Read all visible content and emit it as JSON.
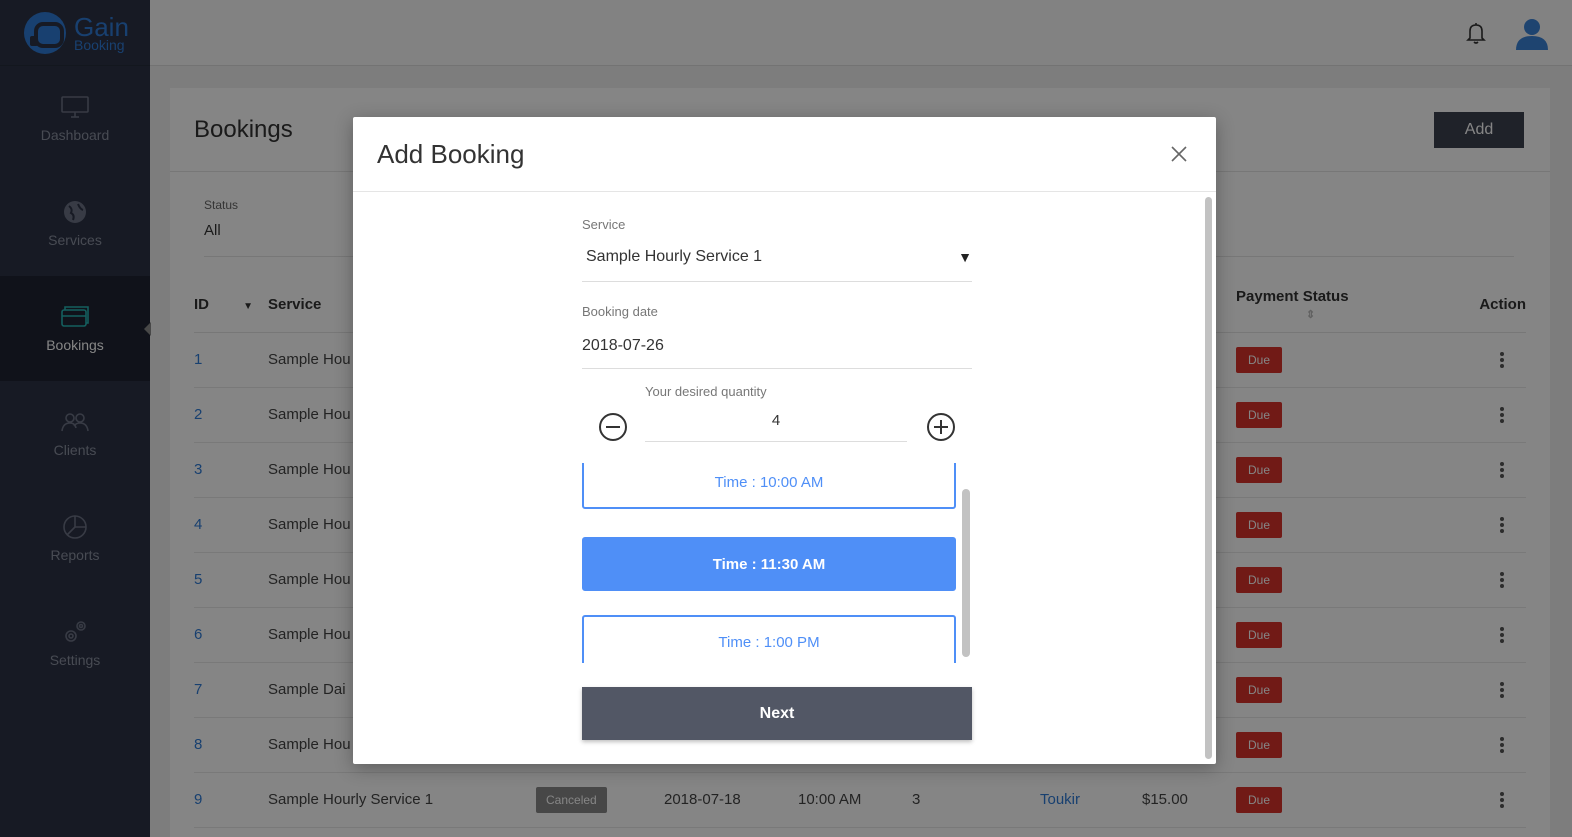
{
  "app": {
    "logo_big": "Gain",
    "logo_small": "Booking"
  },
  "sidebar": {
    "items": [
      {
        "label": "Dashboard",
        "icon": "monitor-icon"
      },
      {
        "label": "Services",
        "icon": "globe-icon"
      },
      {
        "label": "Bookings",
        "icon": "bookings-icon",
        "active": true
      },
      {
        "label": "Clients",
        "icon": "users-icon"
      },
      {
        "label": "Reports",
        "icon": "pie-chart-icon"
      },
      {
        "label": "Settings",
        "icon": "gears-icon"
      }
    ]
  },
  "topbar": {
    "bell_icon": "bell-icon",
    "avatar_icon": "user-avatar-icon"
  },
  "page": {
    "title": "Bookings",
    "add_label": "Add",
    "filter": {
      "label": "Status",
      "value": "All"
    }
  },
  "table": {
    "headers": {
      "id": "ID",
      "service": "Service",
      "payment_status": "Payment Status",
      "action": "Action"
    },
    "rows": [
      {
        "id": "1",
        "service": "Sample Hou",
        "status": "",
        "date": "",
        "time": "",
        "qty": "",
        "client": "",
        "price": "",
        "payment": "Due"
      },
      {
        "id": "2",
        "service": "Sample Hou",
        "status": "",
        "date": "",
        "time": "",
        "qty": "",
        "client": "",
        "price": "",
        "payment": "Due"
      },
      {
        "id": "3",
        "service": "Sample Hou",
        "status": "",
        "date": "",
        "time": "",
        "qty": "",
        "client": "",
        "price": "",
        "payment": "Due"
      },
      {
        "id": "4",
        "service": "Sample Hou",
        "status": "",
        "date": "",
        "time": "",
        "qty": "",
        "client": "",
        "price": "",
        "payment": "Due"
      },
      {
        "id": "5",
        "service": "Sample Hou",
        "status": "",
        "date": "",
        "time": "",
        "qty": "",
        "client": "",
        "price": "",
        "payment": "Due"
      },
      {
        "id": "6",
        "service": "Sample Hou",
        "status": "",
        "date": "",
        "time": "",
        "qty": "",
        "client": "",
        "price": "",
        "payment": "Due"
      },
      {
        "id": "7",
        "service": "Sample Dai",
        "status": "",
        "date": "",
        "time": "",
        "qty": "",
        "client": "",
        "price": "",
        "payment": "Due"
      },
      {
        "id": "8",
        "service": "Sample Hou",
        "status": "",
        "date": "",
        "time": "",
        "qty": "",
        "client": "",
        "price": "",
        "payment": "Due"
      },
      {
        "id": "9",
        "service": "Sample Hourly Service 1",
        "status": "Canceled",
        "date": "2018-07-18",
        "time": "10:00 AM",
        "qty": "3",
        "client": "Toukir",
        "price": "$15.00",
        "payment": "Due"
      }
    ]
  },
  "modal": {
    "title": "Add Booking",
    "service_label": "Service",
    "service_value": "Sample Hourly Service 1",
    "date_label": "Booking date",
    "date_value": "2018-07-26",
    "qty_label": "Your desired quantity",
    "qty_value": "4",
    "slots": [
      {
        "label": "Time : 10:00 AM",
        "selected": false
      },
      {
        "label": "Time : 11:30 AM",
        "selected": true
      },
      {
        "label": "Time : 1:00 PM",
        "selected": false
      }
    ],
    "next_label": "Next"
  },
  "colors": {
    "sidebar_bg": "#2c3345",
    "accent_blue": "#4f8ff7",
    "link_blue": "#2e7bd6",
    "due_red": "#d9332b",
    "next_button": "#525765",
    "active_icon": "#28b5b5"
  }
}
